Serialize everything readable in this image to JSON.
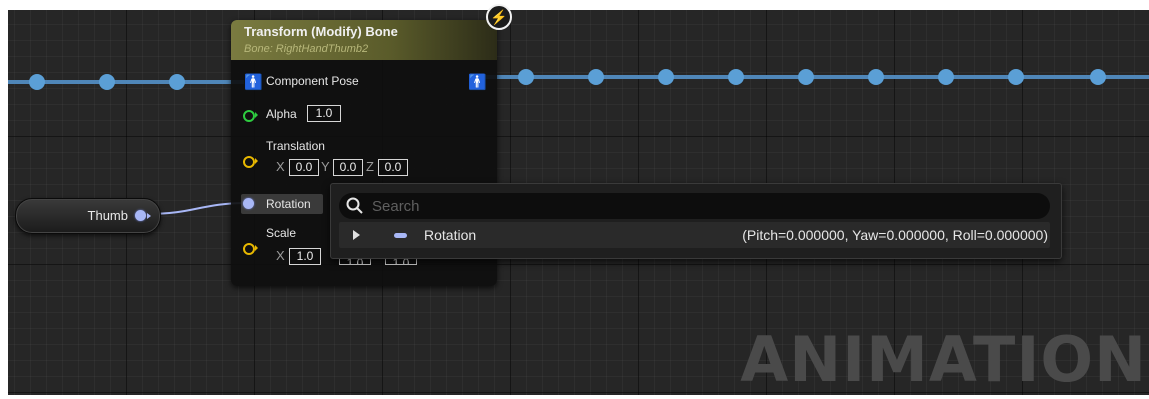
{
  "watermark": "ANIMATION",
  "variable_node": {
    "label": "Thumb"
  },
  "node": {
    "title": "Transform (Modify) Bone",
    "subtitle": "Bone: RightHandThumb2",
    "pins": {
      "component_pose": "Component Pose",
      "alpha": {
        "label": "Alpha",
        "value": "1.0"
      },
      "translation": {
        "label": "Translation",
        "x_label": "X",
        "x": "0.0",
        "y_label": "Y",
        "y": "0.0",
        "z_label": "Z",
        "z": "0.0"
      },
      "rotation": {
        "label": "Rotation"
      },
      "scale": {
        "label": "Scale",
        "x_label": "X",
        "x": "1.0",
        "y": "1.0",
        "z": "1.0"
      }
    }
  },
  "popup": {
    "search_placeholder": "Search",
    "result": {
      "name": "Rotation",
      "value": "(Pitch=0.000000, Yaw=0.000000, Roll=0.000000)"
    }
  },
  "colors": {
    "pose_wire": "#4f86b8",
    "struct_pin": "#a8b7f6",
    "alpha_pin": "#2ecc40",
    "vector_pin": "#e8b800",
    "header": "#7a7b40"
  },
  "icons": [
    "component-pose-icon",
    "exec-icon",
    "search-icon",
    "expand-arrow-icon"
  ]
}
